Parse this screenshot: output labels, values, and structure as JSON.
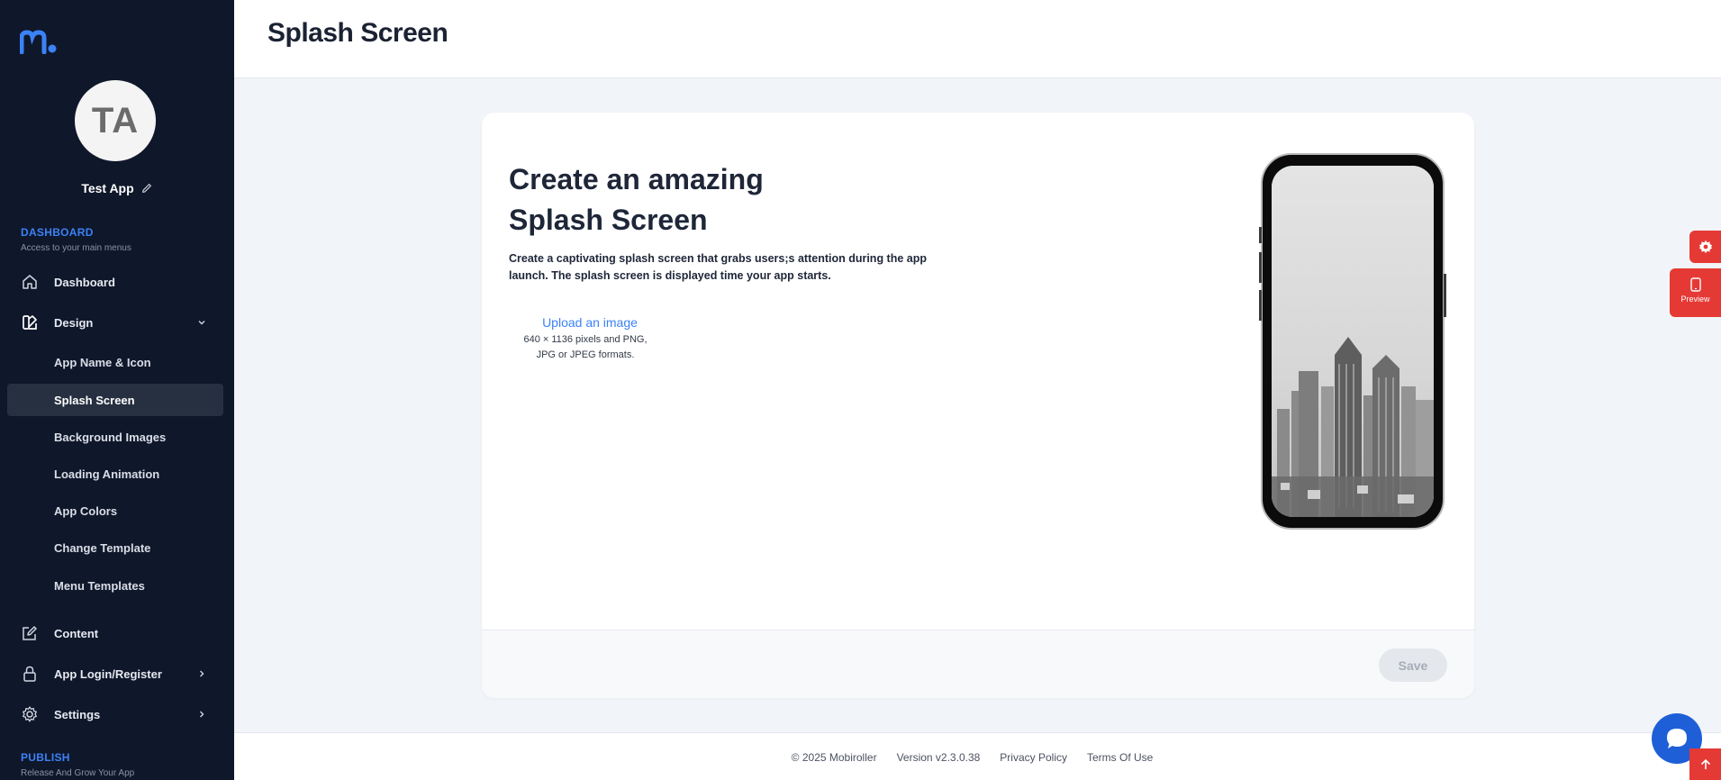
{
  "sidebar": {
    "avatar_initials": "TA",
    "app_name": "Test App",
    "dashboard_section": {
      "title": "DASHBOARD",
      "subtitle": "Access to your main menus"
    },
    "publish_section": {
      "title": "PUBLISH",
      "subtitle": "Release And Grow Your App"
    },
    "nav": {
      "dashboard": "Dashboard",
      "design": "Design",
      "content": "Content",
      "login": "App Login/Register",
      "settings": "Settings"
    },
    "design_items": [
      "App Name & Icon",
      "Splash Screen",
      "Background Images",
      "Loading Animation",
      "App Colors",
      "Change Template",
      "Menu Templates"
    ],
    "active_item": "Splash Screen"
  },
  "header": {
    "title": "Splash Screen"
  },
  "card": {
    "heading_line1": "Create an amazing",
    "heading_line2": "Splash Screen",
    "description": "Create a captivating splash screen that grabs users;s attention during the app launch. The splash screen is displayed time your app starts.",
    "upload_link": "Upload an image",
    "upload_hint_line1": "640 × 1136 pixels and PNG,",
    "upload_hint_line2": "JPG or JPEG formats.",
    "save_label": "Save"
  },
  "floating": {
    "preview_label": "Preview"
  },
  "footer": {
    "copyright": "© 2025 Mobiroller",
    "version": "Version v2.3.0.38",
    "privacy": "Privacy Policy",
    "terms": "Terms Of Use"
  },
  "colors": {
    "sidebar_bg": "#0f172a",
    "accent_blue": "#3b82f6",
    "accent_red": "#e53935",
    "active_bg": "#263041"
  },
  "icons": [
    "logo-icon",
    "pencil-icon",
    "home-icon",
    "palette-icon",
    "chevron-down-icon",
    "edit-icon",
    "lock-icon",
    "gear-icon",
    "chevron-right-icon",
    "phone-icon",
    "chat-icon",
    "arrow-up-icon"
  ]
}
